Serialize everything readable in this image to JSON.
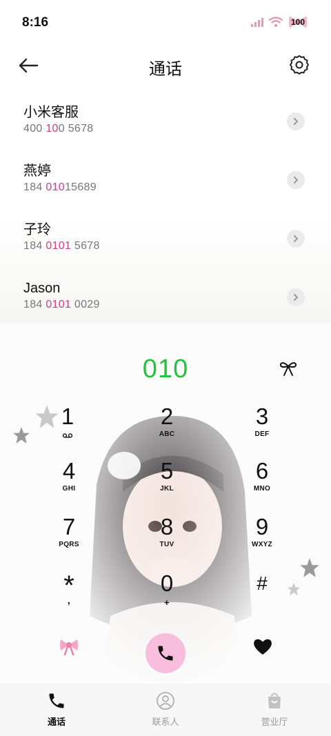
{
  "status_bar": {
    "time": "8:16",
    "battery": "100"
  },
  "header": {
    "title": "通话"
  },
  "contacts": [
    {
      "name": "小米客服",
      "number_parts": [
        "400 ",
        "10",
        "0 5678"
      ]
    },
    {
      "name": "燕婷",
      "number_parts": [
        "184 ",
        "010",
        "15689"
      ]
    },
    {
      "name": "子玲",
      "number_parts": [
        "184 ",
        "0101",
        " 5678"
      ]
    },
    {
      "name": "Jason",
      "number_parts": [
        "184 ",
        "0101",
        " 0029"
      ]
    }
  ],
  "dialer": {
    "input": "010",
    "keys": [
      {
        "digit": "1",
        "letters": ""
      },
      {
        "digit": "2",
        "letters": "ABC"
      },
      {
        "digit": "3",
        "letters": "DEF"
      },
      {
        "digit": "4",
        "letters": "GHI"
      },
      {
        "digit": "5",
        "letters": "JKL"
      },
      {
        "digit": "6",
        "letters": "MNO"
      },
      {
        "digit": "7",
        "letters": "PQRS"
      },
      {
        "digit": "8",
        "letters": "TUV"
      },
      {
        "digit": "9",
        "letters": "WXYZ"
      },
      {
        "digit": "*",
        "letters": ","
      },
      {
        "digit": "0",
        "letters": "+"
      },
      {
        "digit": "#",
        "letters": ""
      }
    ]
  },
  "tabs": [
    {
      "label": "通话",
      "icon": "phone-icon",
      "active": true
    },
    {
      "label": "联系人",
      "icon": "contacts-icon",
      "active": false
    },
    {
      "label": "营业厅",
      "icon": "store-icon",
      "active": false
    }
  ],
  "colors": {
    "accent_green": "#22c43a",
    "highlight_pink": "#d23c86",
    "call_button": "#f8bddc"
  },
  "icons": [
    "back-arrow-icon",
    "gear-icon",
    "chevron-right-icon",
    "bow-icon",
    "voicemail-icon",
    "phone-icon",
    "heart-icon",
    "star-icon",
    "wifi-icon",
    "signal-icon",
    "battery-icon"
  ]
}
